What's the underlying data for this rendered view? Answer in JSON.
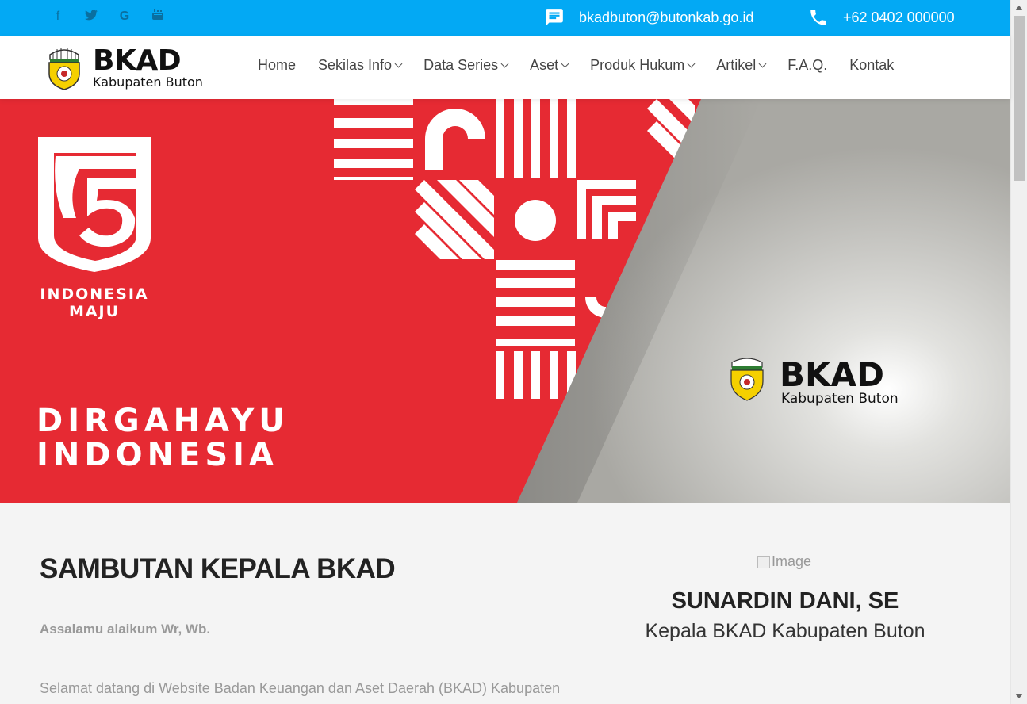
{
  "topbar": {
    "social": [
      {
        "name": "facebook",
        "glyph": "f"
      },
      {
        "name": "twitter",
        "glyph": "t"
      },
      {
        "name": "google",
        "glyph": "G"
      },
      {
        "name": "youtube",
        "glyph": "▶"
      }
    ],
    "email": "bkadbuton@butonkab.go.id",
    "phone": "+62 0402 000000",
    "color": "#03a9f4"
  },
  "logo": {
    "main": "BKAD",
    "sub": "Kabupaten Buton"
  },
  "menu": [
    {
      "label": "Home",
      "dropdown": false
    },
    {
      "label": "Sekilas Info",
      "dropdown": true
    },
    {
      "label": "Data Series",
      "dropdown": true
    },
    {
      "label": "Aset",
      "dropdown": true
    },
    {
      "label": "Produk Hukum",
      "dropdown": true
    },
    {
      "label": "Artikel",
      "dropdown": true
    },
    {
      "label": "F.A.Q.",
      "dropdown": false
    },
    {
      "label": "Kontak",
      "dropdown": false
    }
  ],
  "hero": {
    "badge_line1": "INDONESIA",
    "badge_line2": "MAJU",
    "headline_line1": "DIRGAHAYU",
    "headline_line2": "INDONESIA",
    "logo_main": "BKAD",
    "logo_sub": "Kabupaten Buton",
    "red": "#e62a33",
    "gray": "#b5b4b0"
  },
  "sambutan": {
    "title": "SAMBUTAN KEPALA BKAD",
    "greeting": "Assalamu alaikum Wr, Wb.",
    "welcome": "Selamat datang di Website Badan Keuangan dan Aset Daerah (BKAD) Kabupaten"
  },
  "kepala": {
    "image_alt": "Image",
    "name": "SUNARDIN DANI, SE",
    "role": "Kepala BKAD Kabupaten Buton"
  }
}
